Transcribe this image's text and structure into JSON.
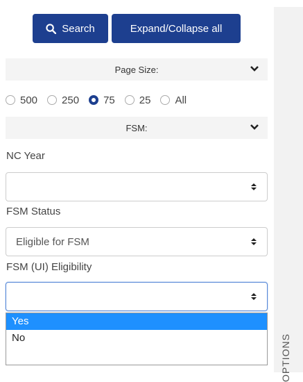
{
  "toolbar": {
    "search_label": "Search",
    "expand_label": "Expand/Collapse all"
  },
  "page_size": {
    "title": "Page Size:",
    "options": [
      "500",
      "250",
      "75",
      "25",
      "All"
    ],
    "selected": "75"
  },
  "fsm_section": {
    "title": "FSM:"
  },
  "fields": {
    "nc_year": {
      "label": "NC Year",
      "value": ""
    },
    "fsm_status": {
      "label": "FSM Status",
      "value": "Eligible for FSM"
    },
    "fsm_ui": {
      "label": "FSM (UI) Eligibility",
      "value": ""
    }
  },
  "dropdown": {
    "options": [
      "Yes",
      "No"
    ],
    "highlighted": "Yes"
  },
  "side_panel": {
    "label": "OPTIONS"
  },
  "colors": {
    "primary": "#1d3f8f",
    "highlight": "#1e90ff"
  }
}
